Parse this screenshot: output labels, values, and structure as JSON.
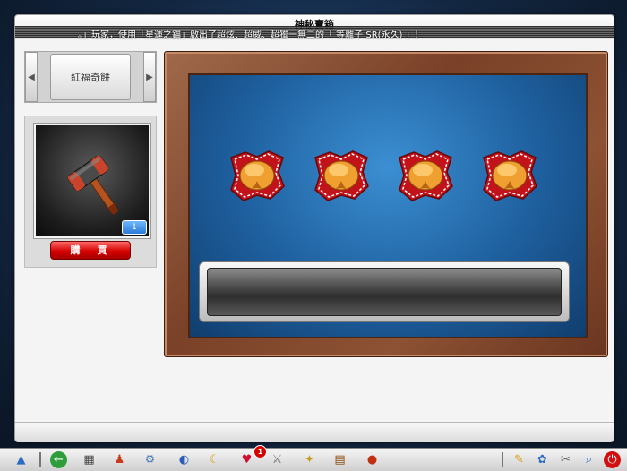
{
  "window": {
    "title": "神秘寶箱",
    "ticker": "。」玩家，使用「星運之錨」啟出了超炫、超威、超獨一無二的「 等離子 SR(永久) 」！"
  },
  "left_panel": {
    "selected_label": "紅福奇餅",
    "item_icon": "hammer-icon",
    "item_quantity": "1",
    "buy_label": "購　買"
  },
  "board": {
    "items": [
      {
        "icon": "fortune-cookie-icon"
      },
      {
        "icon": "fortune-cookie-icon"
      },
      {
        "icon": "fortune-cookie-icon"
      },
      {
        "icon": "fortune-cookie-icon"
      }
    ],
    "result_text": ""
  },
  "taskbar": {
    "notification_count": "1",
    "icons": [
      "start-icon",
      "back-icon",
      "shop-icon",
      "character-icon",
      "settings-gear-icon",
      "globe-icon",
      "banana-icon",
      "heart-icon",
      "sword-icon",
      "wings-icon",
      "book-icon",
      "avatar-icon",
      "notes-icon",
      "paw-icon",
      "tools-icon",
      "search-icon",
      "power-icon"
    ]
  },
  "colors": {
    "board_blue": "#1e5f9e",
    "frame_wood": "#7a4128",
    "buy_red": "#d40000",
    "badge_blue": "#2a7bd8"
  }
}
